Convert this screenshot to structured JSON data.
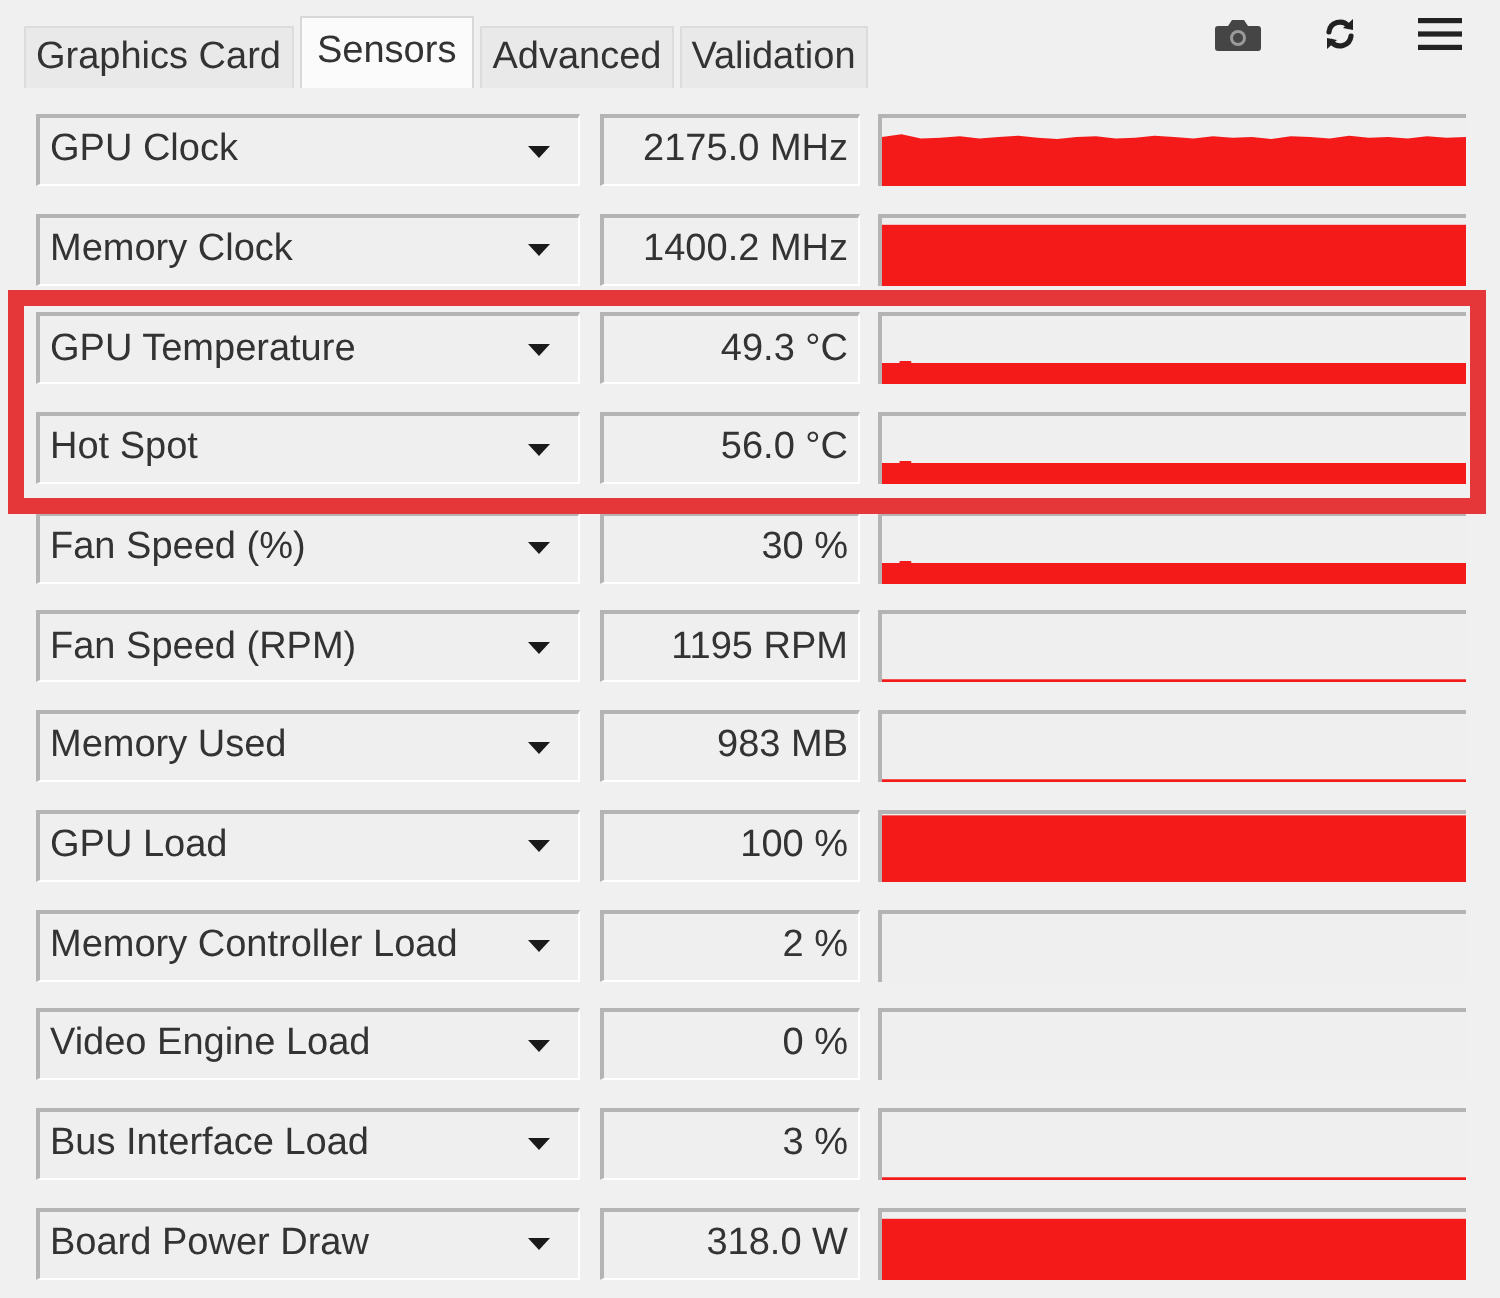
{
  "tabs": [
    {
      "label": "Graphics Card",
      "selected": false
    },
    {
      "label": "Sensors",
      "selected": true
    },
    {
      "label": "Advanced",
      "selected": false
    },
    {
      "label": "Validation",
      "selected": false
    }
  ],
  "sensors": [
    {
      "name": "GPU Clock",
      "value": "2175.0 MHz",
      "kind": "wavy",
      "highlighted": false
    },
    {
      "name": "Memory Clock",
      "value": "1400.2 MHz",
      "kind": "high",
      "highlighted": false
    },
    {
      "name": "GPU Temperature",
      "value": "49.3 °C",
      "kind": "low",
      "highlighted": true
    },
    {
      "name": "Hot Spot",
      "value": "56.0 °C",
      "kind": "low",
      "highlighted": true
    },
    {
      "name": "Fan Speed (%)",
      "value": "30 %",
      "kind": "low",
      "highlighted": false
    },
    {
      "name": "Fan Speed (RPM)",
      "value": "1195 RPM",
      "kind": "trace",
      "highlighted": false
    },
    {
      "name": "Memory Used",
      "value": "983 MB",
      "kind": "trace",
      "highlighted": false
    },
    {
      "name": "GPU Load",
      "value": "100 %",
      "kind": "full",
      "highlighted": false
    },
    {
      "name": "Memory Controller Load",
      "value": "2 %",
      "kind": "empty",
      "highlighted": false
    },
    {
      "name": "Video Engine Load",
      "value": "0 %",
      "kind": "empty",
      "highlighted": false
    },
    {
      "name": "Bus Interface Load",
      "value": "3 %",
      "kind": "trace",
      "highlighted": false
    },
    {
      "name": "Board Power Draw",
      "value": "318.0 W",
      "kind": "high",
      "highlighted": false
    }
  ]
}
